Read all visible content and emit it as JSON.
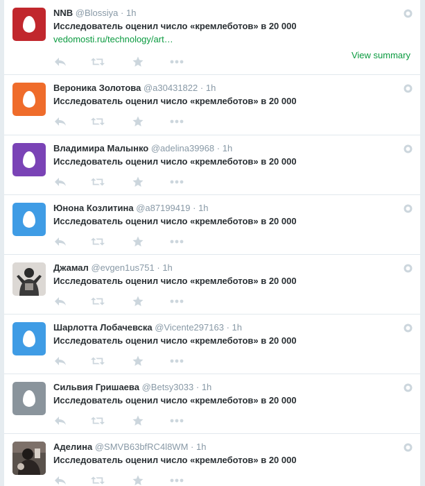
{
  "tweets": [
    {
      "name": "NNB",
      "handle": "@Blossiya",
      "time": "1h",
      "text": "Исследователь оценил число «кремлеботов» в 20 000",
      "link": "vedomosti.ru/technology/art…",
      "summary": "View summary",
      "avatar": {
        "type": "egg",
        "color": "#c1272d"
      }
    },
    {
      "name": "Вероника Золотова",
      "handle": "@a30431822",
      "time": "1h",
      "text": "Исследователь оценил число «кремлеботов» в 20 000",
      "avatar": {
        "type": "egg",
        "color": "#ef6c2b"
      }
    },
    {
      "name": "Владимира Малынко",
      "handle": "@adelina39968",
      "time": "1h",
      "text": "Исследователь оценил число «кремлеботов» в 20 000",
      "avatar": {
        "type": "egg",
        "color": "#7a43b6"
      }
    },
    {
      "name": "Юнона Козлитина",
      "handle": "@a87199419",
      "time": "1h",
      "text": "Исследователь оценил число «кремлеботов» в 20 000",
      "avatar": {
        "type": "egg",
        "color": "#3f9ce5"
      }
    },
    {
      "name": "Джамал",
      "handle": "@evgen1us751",
      "time": "1h",
      "text": "Исследователь оценил число «кремлеботов» в 20 000",
      "avatar": {
        "type": "photo",
        "color": "#d7d3d0"
      }
    },
    {
      "name": "Шарлотта Лобачевска",
      "handle": "@Vicente297163",
      "time": "1h",
      "text": "Исследователь оценил число «кремлеботов» в 20 000",
      "avatar": {
        "type": "egg",
        "color": "#3f9ce5"
      }
    },
    {
      "name": "Сильвия Гришаева",
      "handle": "@Betsy3033",
      "time": "1h",
      "text": "Исследователь оценил число «кремлеботов» в 20 000",
      "avatar": {
        "type": "egg",
        "color": "#8a949c"
      }
    },
    {
      "name": "Аделина",
      "handle": "@SMVB63bfRC4l8WM",
      "time": "1h",
      "text": "Исследователь оценил число «кремлеботов» в 20 000",
      "avatar": {
        "type": "photo",
        "color": "#4a4542"
      }
    }
  ],
  "icons": {
    "reply": "reply-icon",
    "retweet": "retweet-icon",
    "favorite": "star-icon",
    "more": "more-icon",
    "globe": "globe-icon"
  },
  "colors": {
    "link": "#0a9a3f",
    "icon": "#ccd6dd",
    "muted": "#8899a6"
  }
}
